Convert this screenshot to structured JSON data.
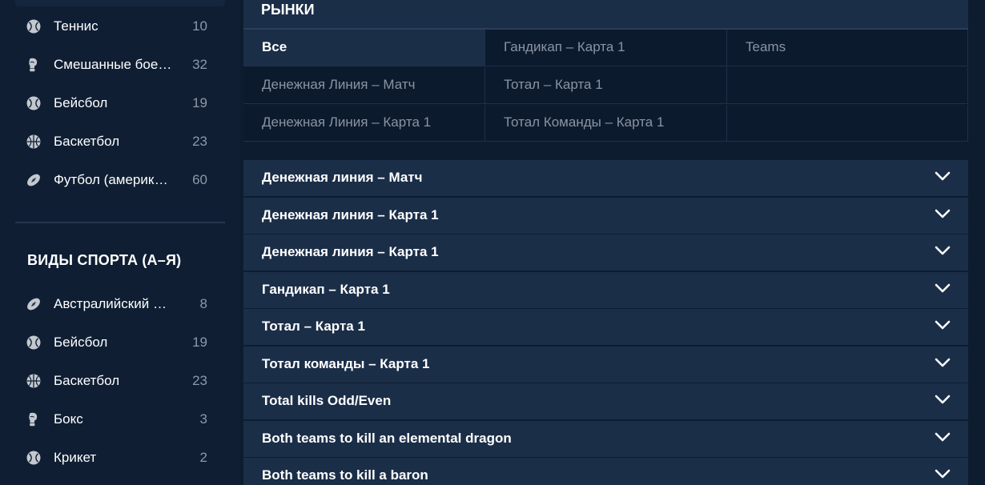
{
  "sidebar": {
    "top_sports": [
      {
        "label": "Теннис",
        "count": "10",
        "icon": "tennis-ball-icon"
      },
      {
        "label": "Смешанные боевые искусства",
        "count": "32",
        "icon": "boxing-glove-icon"
      },
      {
        "label": "Бейсбол",
        "count": "19",
        "icon": "baseball-icon"
      },
      {
        "label": "Баскетбол",
        "count": "23",
        "icon": "basketball-icon"
      },
      {
        "label": "Футбол (американский)",
        "count": "60",
        "icon": "american-football-icon"
      }
    ],
    "all_sports_heading": "ВИДЫ СПОРТА (А–Я)",
    "all_sports": [
      {
        "label": "Австралийский футбол",
        "count": "8",
        "icon": "rugby-ball-icon"
      },
      {
        "label": "Бейсбол",
        "count": "19",
        "icon": "baseball-icon"
      },
      {
        "label": "Баскетбол",
        "count": "23",
        "icon": "basketball-icon"
      },
      {
        "label": "Бокс",
        "count": "3",
        "icon": "boxing-glove-icon"
      },
      {
        "label": "Крикет",
        "count": "2",
        "icon": "cricket-ball-icon"
      }
    ]
  },
  "markets": {
    "title": "РЫНКИ",
    "filters": [
      [
        "Все",
        "Гандикап – Карта 1",
        "Teams"
      ],
      [
        "Денежная Линия – Матч",
        "Тотал – Карта 1",
        ""
      ],
      [
        "Денежная Линия – Карта 1",
        "Тотал Команды – Карта 1",
        ""
      ]
    ],
    "active_filter": "Все"
  },
  "accordion": {
    "items": [
      "Денежная линия – Матч",
      "Денежная линия – Карта 1",
      "Денежная линия – Карта 1",
      "Гандикап – Карта 1",
      "Тотал – Карта 1",
      "Тотал команды – Карта 1",
      "Total kills Odd/Even",
      "Both teams to kill an elemental dragon",
      "Both teams to kill a baron"
    ],
    "chevron_icon": "chevron-down-icon"
  },
  "colors": {
    "page_bg": "#0e1c2f",
    "panel_bg": "#1b2e48",
    "muted_text": "#8994a3",
    "icon_gray": "#c3c8cf"
  }
}
